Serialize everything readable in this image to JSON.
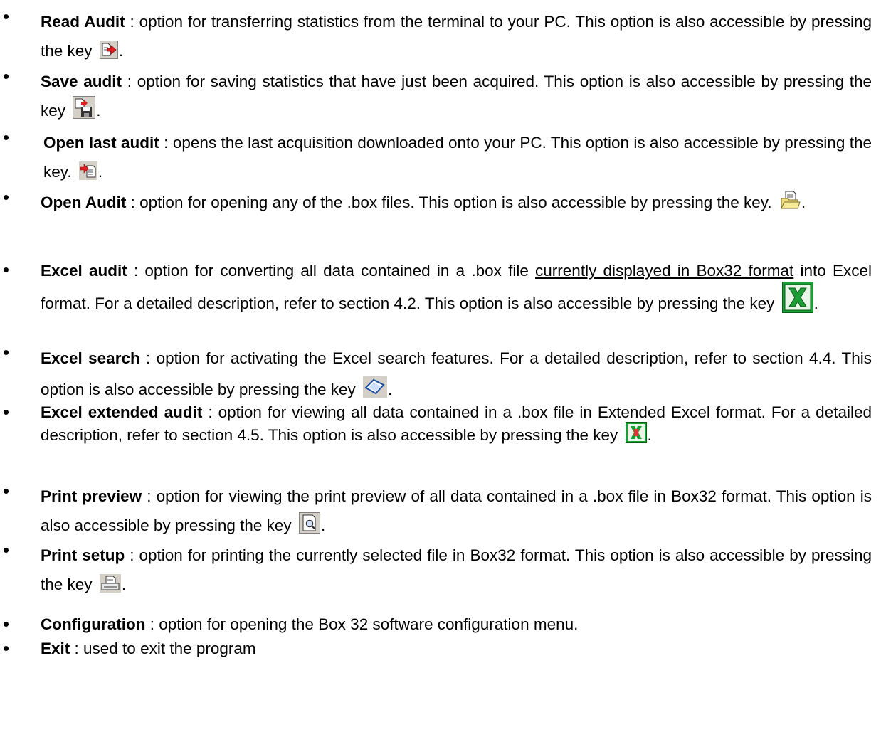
{
  "options": [
    {
      "name": "Read Audit",
      "desc": " : option for transferring statistics from the terminal to your PC. This option is also accessible by pressing the key",
      "icon": "read-audit-icon",
      "end": "."
    },
    {
      "name": "Save audit",
      "desc": " : option for saving statistics that have just been acquired. This option is also accessible by pressing the key",
      "icon": "save-audit-icon",
      "end": "."
    },
    {
      "name": "Open last audit",
      "desc": " : opens the last acquisition downloaded onto your PC. This option is also accessible by pressing the key.",
      "icon": "open-last-audit-icon",
      "end": "."
    },
    {
      "name": "Open Audit",
      "desc": " : option for opening any of the .box files. This option is also accessible by pressing the key.",
      "icon": "open-audit-icon",
      "end": "."
    },
    {
      "name": "Excel audit",
      "desc_a": " : option for converting all data contained in a .box file ",
      "underlined": "currently displayed in Box32 format",
      "desc_b": " into Excel format. For a detailed description, refer to section 4.2. This option is also accessible by pressing the key",
      "icon": "excel-icon",
      "end": "."
    },
    {
      "name": "Excel search",
      "desc": " : option for activating the Excel search features. For a detailed description, refer to section 4.4. This option is also accessible by pressing the key",
      "icon": "excel-search-icon",
      "end": "."
    },
    {
      "name": "Excel extended audit",
      "desc": " : option for viewing all data contained in a .box file in Extended Excel format. For a detailed description, refer to section 4.5. This option is also accessible by pressing the key",
      "icon": "excel-extended-icon",
      "end": "."
    },
    {
      "name": "Print preview",
      "desc": " : option for viewing the print preview of all data contained in a .box file in Box32 format. This option is also accessible by pressing the key",
      "icon": "print-preview-icon",
      "end": "."
    },
    {
      "name": "Print setup",
      "desc": " : option for printing the currently selected file in Box32 format. This option is also accessible by pressing the key",
      "icon": "printer-icon",
      "end": "."
    },
    {
      "name": "Configuration",
      "desc": " : option for opening the Box 32 software configuration menu."
    },
    {
      "name": "Exit",
      "desc": " : used to exit the program"
    }
  ],
  "bullet": "•"
}
